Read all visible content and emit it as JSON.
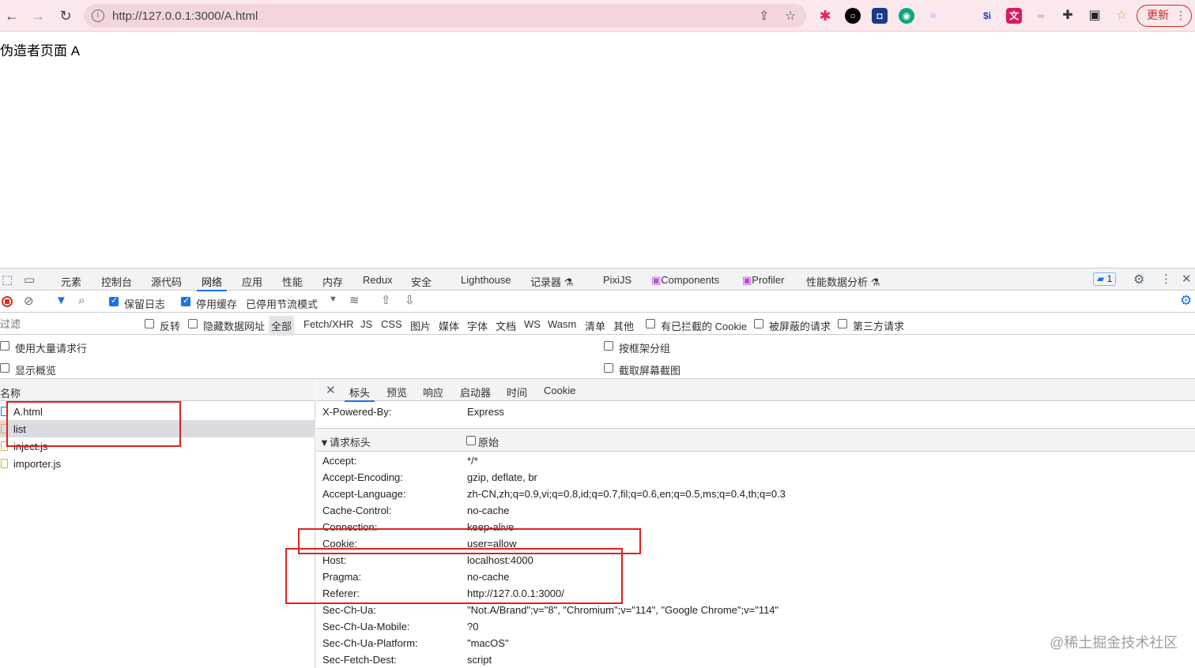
{
  "browser": {
    "url": "http://127.0.0.1:3000/A.html",
    "update_label": "更新",
    "ext_si": "$i"
  },
  "page": {
    "heading": "伪造者页面 A"
  },
  "devtools": {
    "tabs": [
      {
        "label": "元素"
      },
      {
        "label": "控制台"
      },
      {
        "label": "源代码"
      },
      {
        "label": "网络"
      },
      {
        "label": "应用"
      },
      {
        "label": "性能"
      },
      {
        "label": "内存"
      },
      {
        "label": "Redux"
      },
      {
        "label": "安全"
      },
      {
        "label": "Lighthouse"
      },
      {
        "label": "记录器"
      },
      {
        "label": "PixiJS"
      },
      {
        "label": "Components"
      },
      {
        "label": "Profiler"
      },
      {
        "label": "性能数据分析"
      }
    ],
    "active_tab": "网络",
    "issues_count": "1",
    "toolbar": {
      "preserve_log": "保留日志",
      "disable_cache": "停用缓存",
      "throttle": "已停用节流模式"
    },
    "filter": {
      "placeholder": "过滤",
      "invert": "反转",
      "hide_data_urls": "隐藏数据网址",
      "types": [
        "全部",
        "Fetch/XHR",
        "JS",
        "CSS",
        "图片",
        "媒体",
        "字体",
        "文档",
        "WS",
        "Wasm",
        "清单",
        "其他"
      ],
      "blocked_cookies": "有已拦截的 Cookie",
      "blocked_requests": "被屏蔽的请求",
      "third_party": "第三方请求"
    },
    "options": {
      "big_rows": "使用大量请求行",
      "overview": "显示概览",
      "group_by_frame": "按框架分组",
      "screenshots": "截取屏幕截图"
    },
    "request_list": {
      "header": "名称",
      "rows": [
        {
          "name": "A.html"
        },
        {
          "name": "list"
        },
        {
          "name": "inject.js"
        },
        {
          "name": "importer.js"
        }
      ]
    },
    "detail": {
      "tabs": [
        {
          "label": "标头"
        },
        {
          "label": "预览"
        },
        {
          "label": "响应"
        },
        {
          "label": "启动器"
        },
        {
          "label": "时间"
        },
        {
          "label": "Cookie"
        }
      ],
      "powered_by": {
        "key": "X-Powered-By:",
        "value": "Express"
      },
      "section_title": "▼请求标头",
      "raw_label": "原始",
      "request_headers": [
        {
          "key": "Accept:",
          "value": "*/*"
        },
        {
          "key": "Accept-Encoding:",
          "value": "gzip, deflate, br"
        },
        {
          "key": "Accept-Language:",
          "value": "zh-CN,zh;q=0.9,vi;q=0.8,id;q=0.7,fil;q=0.6,en;q=0.5,ms;q=0.4,th;q=0.3"
        },
        {
          "key": "Cache-Control:",
          "value": "no-cache"
        },
        {
          "key": "Connection:",
          "value": "keep-alive"
        },
        {
          "key": "Cookie:",
          "value": "user=allow"
        },
        {
          "key": "Host:",
          "value": "localhost:4000"
        },
        {
          "key": "Pragma:",
          "value": "no-cache"
        },
        {
          "key": "Referer:",
          "value": "http://127.0.0.1:3000/"
        },
        {
          "key": "Sec-Ch-Ua:",
          "value": "\"Not.A/Brand\";v=\"8\", \"Chromium\";v=\"114\", \"Google Chrome\";v=\"114\""
        },
        {
          "key": "Sec-Ch-Ua-Mobile:",
          "value": "?0"
        },
        {
          "key": "Sec-Ch-Ua-Platform:",
          "value": "\"macOS\""
        },
        {
          "key": "Sec-Fetch-Dest:",
          "value": "script"
        }
      ]
    }
  },
  "watermark": "@稀土掘金技术社区"
}
